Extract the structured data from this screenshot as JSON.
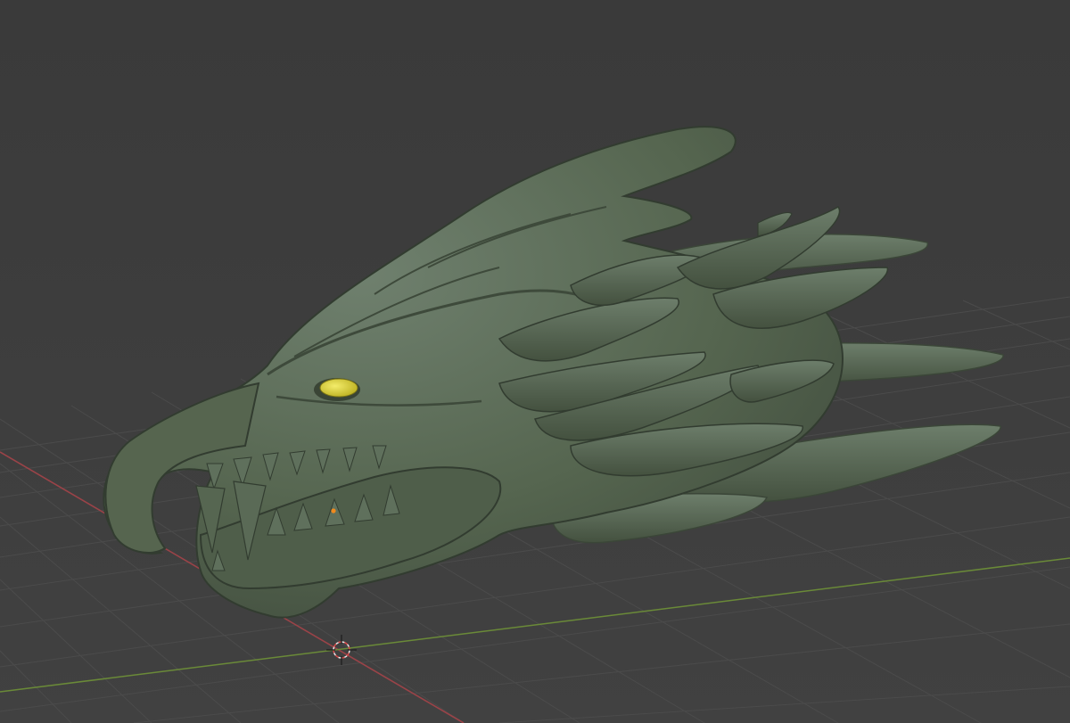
{
  "viewport": {
    "background": "#3d3d3d",
    "grid_color": "#4a4a4a",
    "x_axis_color": "#a84a4f",
    "y_axis_color": "#6a8c3a",
    "model_color": "#5a6b5a",
    "eye_color": "#e8e03a"
  },
  "scene": {
    "object": "dragon-head-sculpt",
    "shading": "solid",
    "cursor": "3d-cursor",
    "origin_marker": "object-origin"
  }
}
